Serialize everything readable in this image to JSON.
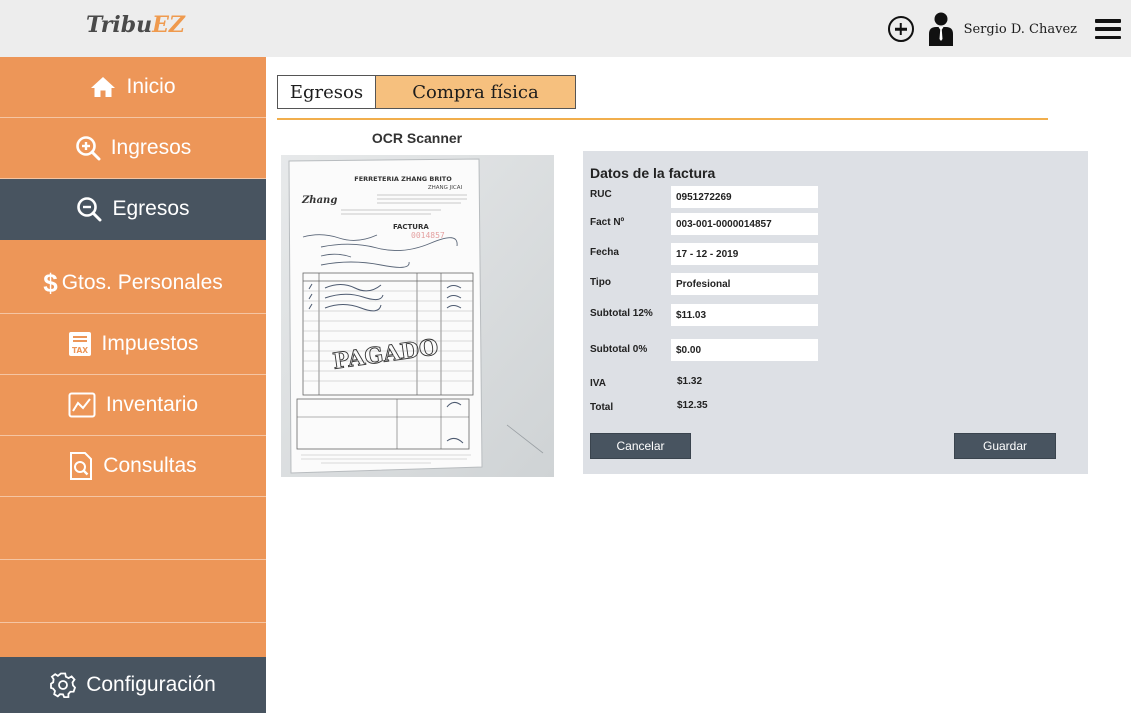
{
  "header": {
    "brand_main": "Tribu",
    "brand_accent": "EZ",
    "user_name": "Sergio D. Chavez",
    "icons": [
      "plus-circle-icon",
      "user-icon",
      "hamburger-menu-icon"
    ]
  },
  "sidebar": {
    "items": [
      {
        "label": "Inicio",
        "icon": "home-icon"
      },
      {
        "label": "Ingresos",
        "icon": "zoom-in-icon"
      },
      {
        "label": "Egresos",
        "icon": "zoom-out-icon",
        "active": true
      },
      {
        "label": "Gtos. Personales",
        "icon": "dollar-icon"
      },
      {
        "label": "Impuestos",
        "icon": "tax-icon"
      },
      {
        "label": "Inventario",
        "icon": "chart-icon"
      },
      {
        "label": "Consultas",
        "icon": "document-search-icon"
      }
    ],
    "footer": {
      "label": "Configuración",
      "icon": "gear-icon"
    }
  },
  "tabs": [
    "Egresos",
    "Compra física"
  ],
  "ocr": {
    "title": "OCR Scanner",
    "receipt": {
      "store": "FERRETERIA ZHANG BRITO",
      "sub": "ZHANG JICAI",
      "doc": "FACTURA",
      "number": "0014857",
      "logo": "Zhang",
      "stamp": "PAGADO"
    }
  },
  "form": {
    "title": "Datos de la factura",
    "fields": [
      {
        "label": "RUC",
        "value": "0951272269"
      },
      {
        "label": "Fact Nº",
        "value": "003-001-0000014857"
      },
      {
        "label": "Fecha",
        "value": "17 - 12 - 2019"
      },
      {
        "label": "Tipo",
        "value": "Profesional"
      },
      {
        "label": "Subtotal 12%",
        "value": "$11.03"
      },
      {
        "label": "Subtotal 0%",
        "value": "$0.00"
      }
    ],
    "totals": [
      {
        "label": "IVA",
        "value": "$1.32"
      },
      {
        "label": "Total",
        "value": "$12.35"
      }
    ],
    "cancel_label": "Cancelar",
    "save_label": "Guardar"
  },
  "colors": {
    "sidebar_orange": "#ed9658",
    "sidebar_dark": "#485460",
    "tab_active": "#f6c07e",
    "divider": "#f1ae4c",
    "panel_bg": "#dde0e5"
  }
}
